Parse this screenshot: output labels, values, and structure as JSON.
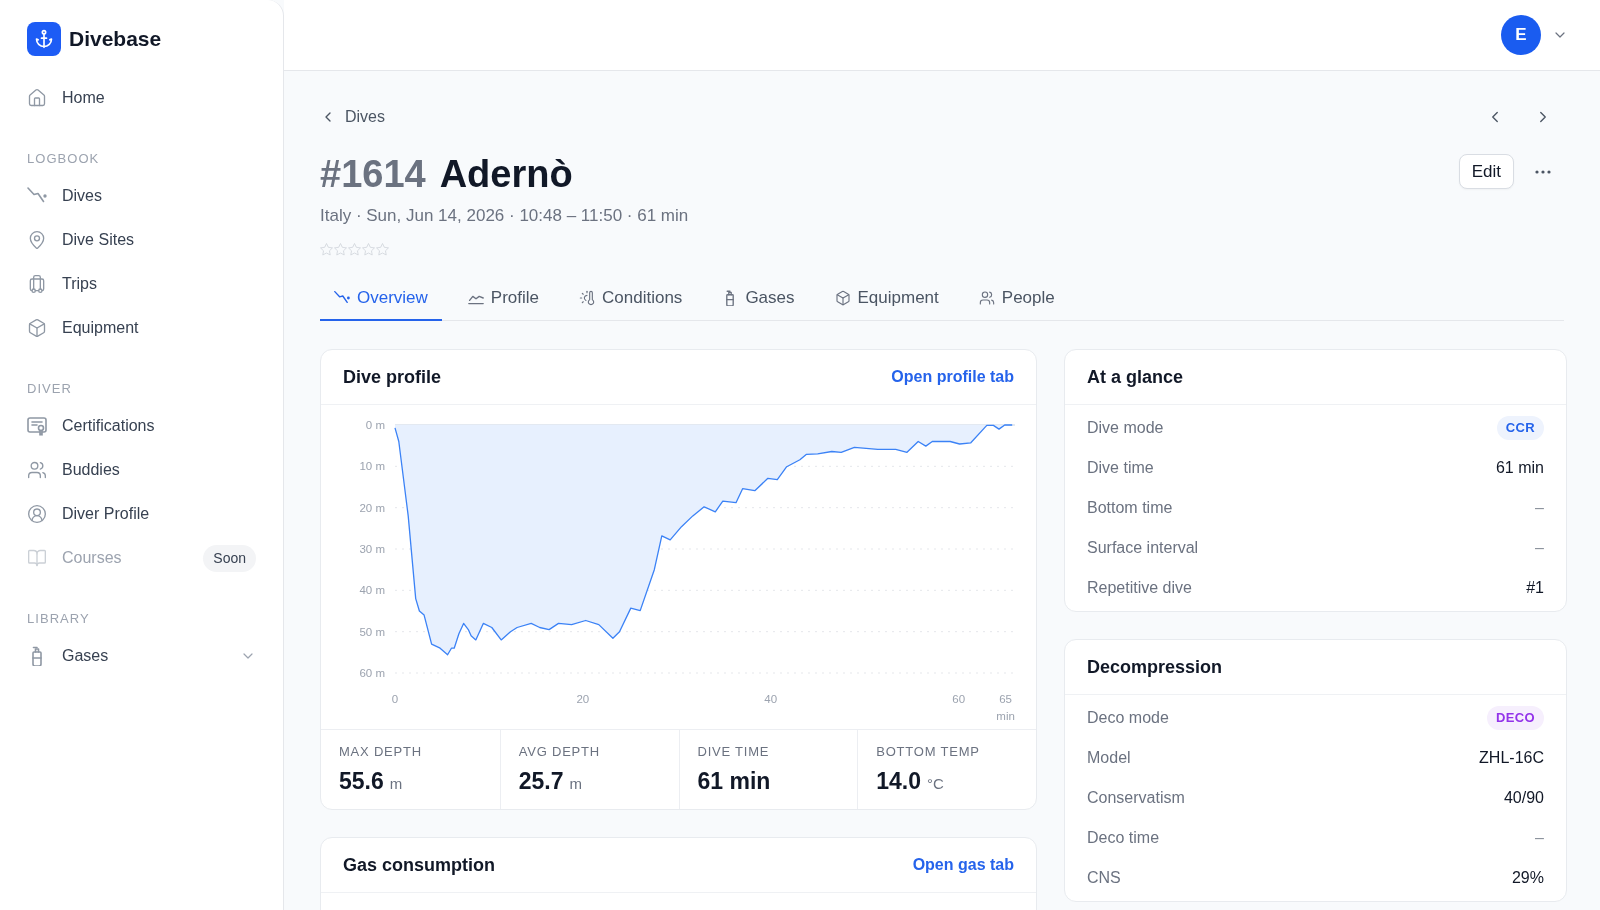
{
  "sidebar": {
    "brand": "Divebase",
    "sections": [
      {
        "items": [
          {
            "label": "Home",
            "kind": "link",
            "selected": false,
            "disabled": false
          }
        ]
      },
      {
        "heading": "LOGBOOK",
        "items": [
          {
            "label": "Dives",
            "kind": "link",
            "selected": false,
            "disabled": false
          },
          {
            "label": "Dive Sites",
            "kind": "link",
            "selected": false,
            "disabled": false
          },
          {
            "label": "Trips",
            "kind": "link",
            "selected": false,
            "disabled": false
          },
          {
            "label": "Equipment",
            "kind": "link",
            "selected": false,
            "disabled": false
          }
        ]
      },
      {
        "heading": "DIVER",
        "items": [
          {
            "label": "Certifications",
            "kind": "link",
            "selected": false,
            "disabled": false
          },
          {
            "label": "Buddies",
            "kind": "link",
            "selected": false,
            "disabled": false
          },
          {
            "label": "Diver Profile",
            "kind": "link",
            "selected": false,
            "disabled": false
          },
          {
            "label": "Courses",
            "kind": "link",
            "selected": false,
            "disabled": true,
            "badge": "Soon"
          }
        ]
      },
      {
        "heading": "LIBRARY",
        "items": [
          {
            "label": "Gases",
            "kind": "group",
            "selected": false,
            "disabled": false,
            "expanded": false
          }
        ]
      }
    ]
  },
  "account": {
    "initial": "E"
  },
  "breadcrumb": {
    "label": "Dives"
  },
  "dive": {
    "number": "#1614",
    "name": "Adernò",
    "meta": "Italy · Sun, Jun 14, 2026 · 10:48 – 11:50 · 61 min",
    "stars": 0
  },
  "actions": {
    "edit": "Edit"
  },
  "tabs": [
    {
      "label": "Overview",
      "selected": true
    },
    {
      "label": "Profile",
      "selected": false
    },
    {
      "label": "Conditions",
      "selected": false
    },
    {
      "label": "Gases",
      "selected": false
    },
    {
      "label": "Equipment",
      "selected": false
    },
    {
      "label": "People",
      "selected": false
    }
  ],
  "dive_profile": {
    "title": "Dive profile",
    "link": "Open profile tab",
    "chart_data": {
      "type": "area",
      "grid": true,
      "xlabel": "min",
      "x": [
        0,
        0.4,
        1.4,
        2.2,
        2.6,
        3.1,
        3.9,
        4.8,
        5.6,
        6.0,
        6.3,
        6.8,
        7.3,
        7.8,
        8.1,
        8.6,
        9.4,
        10.3,
        11.3,
        12.3,
        13.0,
        14.5,
        15.4,
        16.4,
        17.4,
        18.8,
        20.3,
        21.7,
        23.2,
        23.9,
        25.1,
        26.1,
        27.6,
        28.4,
        29.3,
        30.5,
        31.7,
        32.9,
        34.1,
        34.9,
        36.3,
        37.0,
        38.3,
        39.7,
        40.7,
        41.7,
        43.1,
        43.8,
        45.0,
        46.5,
        47.5,
        48.9,
        51.4,
        53.3,
        54.5,
        55.7,
        56.5,
        57.2,
        59.1,
        60.1,
        61.3,
        63.0,
        63.7,
        64.3,
        64.9,
        65.7
      ],
      "series": [
        {
          "color": "#3b82f6",
          "values": [
            0.7,
            4,
            22,
            42,
            45,
            46,
            53,
            54,
            55.6,
            54,
            54,
            50.5,
            48,
            49.5,
            51,
            52,
            48,
            49,
            52,
            50,
            49,
            48,
            49,
            49.5,
            48,
            48.3,
            47.3,
            48.3,
            51.6,
            50,
            44.3,
            44.9,
            35,
            26.8,
            27.8,
            24.6,
            22,
            19.8,
            21,
            18.4,
            18.8,
            15.4,
            15.9,
            12.9,
            13.2,
            10.1,
            8.4,
            7.1,
            7.0,
            6.4,
            6.6,
            5.4,
            5.9,
            5.9,
            6.6,
            4.0,
            5.1,
            4.0,
            4.0,
            4.6,
            4.3,
            0.1,
            0.1,
            1.0,
            0,
            0
          ]
        }
      ],
      "xlim": [
        0,
        66
      ],
      "ylim": [
        60,
        0
      ],
      "xticks": [
        0,
        20,
        40,
        60,
        65
      ],
      "yticks": [
        {
          "value": 0,
          "label": "0 m"
        },
        {
          "value": 10,
          "label": "10 m"
        },
        {
          "value": 20,
          "label": "20 m"
        },
        {
          "value": 30,
          "label": "30 m"
        },
        {
          "value": 40,
          "label": "40 m"
        },
        {
          "value": 50,
          "label": "50 m"
        },
        {
          "value": 60,
          "label": "60 m"
        }
      ]
    },
    "stats": [
      {
        "label": "MAX DEPTH",
        "value": "55.6",
        "unit": "m"
      },
      {
        "label": "AVG DEPTH",
        "value": "25.7",
        "unit": "m"
      },
      {
        "label": "DIVE TIME",
        "value": "61 min"
      },
      {
        "label": "BOTTOM TEMP",
        "value": "14.0",
        "unit": "°C"
      }
    ]
  },
  "gas_consumption": {
    "title": "Gas consumption",
    "link": "Open gas tab"
  },
  "at_a_glance": {
    "title": "At a glance",
    "rows": [
      {
        "label": "Dive mode",
        "value": "CCR",
        "kind": "badge",
        "color": "#2563eb"
      },
      {
        "label": "Dive time",
        "value": "61 min",
        "kind": "text"
      },
      {
        "label": "Bottom time",
        "value": "–",
        "kind": "empty"
      },
      {
        "label": "Surface interval",
        "value": "–",
        "kind": "empty"
      },
      {
        "label": "Repetitive dive",
        "value": "#1",
        "kind": "text"
      }
    ]
  },
  "decompression": {
    "title": "Decompression",
    "rows": [
      {
        "label": "Deco mode",
        "value": "DECO",
        "kind": "badge",
        "color": "#9333ea"
      },
      {
        "label": "Model",
        "value": "ZHL-16C",
        "kind": "text"
      },
      {
        "label": "Conservatism",
        "value": "40/90",
        "kind": "text"
      },
      {
        "label": "Deco time",
        "value": "–",
        "kind": "empty"
      },
      {
        "label": "CNS",
        "value": "29%",
        "kind": "text"
      }
    ]
  }
}
